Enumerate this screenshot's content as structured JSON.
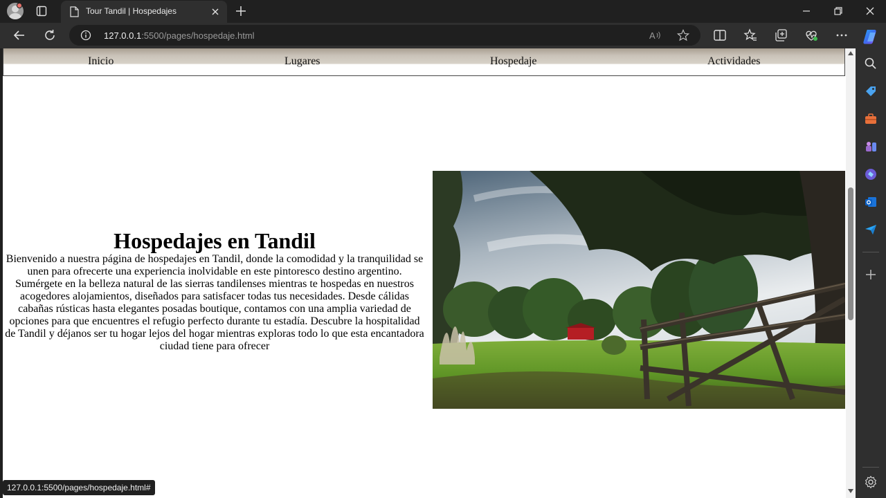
{
  "browser": {
    "tab_title": "Tour Tandil | Hospedajes",
    "url_host": "127.0.0.1",
    "url_rest": ":5500/pages/hospedaje.html",
    "status_link": "127.0.0.1:5500/pages/hospedaje.html#"
  },
  "nav": {
    "items": [
      {
        "label": "Inicio"
      },
      {
        "label": "Lugares"
      },
      {
        "label": "Hospedaje"
      },
      {
        "label": "Actividades"
      }
    ]
  },
  "main": {
    "heading": "Hospedajes en Tandil",
    "body": "Bienvenido a nuestra página de hospedajes en Tandil, donde la comodidad y la tranquilidad se unen para ofrecerte una experiencia inolvidable en este pintoresco destino argentino. Sumérgete en la belleza natural de las sierras tandilenses mientras te hospedas en nuestros acogedores alojamientos, diseñados para satisfacer todas tus necesidades. Desde cálidas cabañas rústicas hasta elegantes posadas boutique, contamos con una amplia variedad de opciones para que encuentres el refugio perfecto durante tu estadía. Descubre la hospitalidad de Tandil y déjanos ser tu hogar lejos del hogar mientras exploras todo lo que esta encantadora ciudad tiene para ofrecer"
  },
  "colors": {
    "chrome_dark": "#202020",
    "chrome_mid": "#2f2f2f",
    "page_bg": "#ffffff"
  },
  "icons": [
    "profile-icon",
    "tab-actions-icon",
    "page-icon",
    "close-icon",
    "new-tab-icon",
    "minimize-icon",
    "maximize-icon",
    "window-close-icon",
    "back-icon",
    "refresh-icon",
    "info-icon",
    "read-aloud-icon",
    "favorite-icon",
    "split-screen-icon",
    "favorites-icon",
    "collections-icon",
    "performance-icon",
    "more-icon",
    "copilot-icon",
    "search-icon",
    "tag-icon",
    "toolbox-icon",
    "games-icon",
    "copilot-app-icon",
    "outlook-icon",
    "send-icon",
    "add-icon",
    "settings-icon"
  ]
}
